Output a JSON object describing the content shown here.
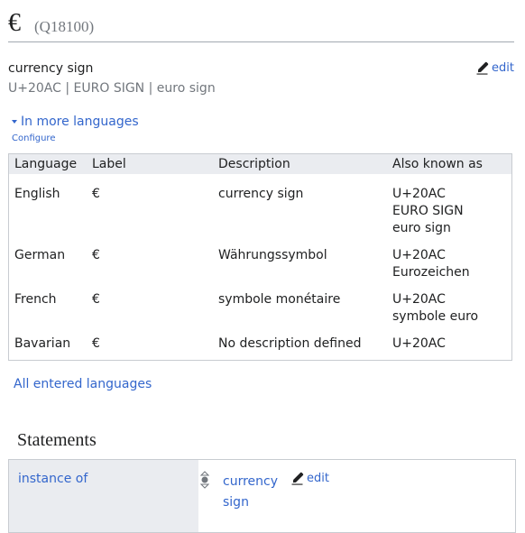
{
  "header": {
    "label": "€",
    "qid": "(Q18100)"
  },
  "description": "currency sign",
  "aliases": [
    "U+20AC",
    "EURO SIGN",
    "euro sign"
  ],
  "alias_separator": " | ",
  "edit_label": "edit",
  "languages_toggle": "In more languages",
  "configure_label": "Configure",
  "table": {
    "headers": [
      "Language",
      "Label",
      "Description",
      "Also known as"
    ],
    "rows": [
      {
        "language": "English",
        "label": "€",
        "description": "currency sign",
        "aliases": [
          "U+20AC",
          "EURO SIGN",
          "euro sign"
        ]
      },
      {
        "language": "German",
        "label": "€",
        "description": "Währungssymbol",
        "aliases": [
          "U+20AC",
          "Eurozeichen"
        ]
      },
      {
        "language": "French",
        "label": "€",
        "description": "symbole monétaire",
        "aliases": [
          "U+20AC",
          "symbole euro"
        ]
      },
      {
        "language": "Bavarian",
        "label": "€",
        "description": "No description defined",
        "aliases": [
          "U+20AC"
        ]
      }
    ]
  },
  "all_languages_link": "All entered languages",
  "statements": {
    "heading": "Statements",
    "items": [
      {
        "property": "instance of",
        "value": "currency sign",
        "edit_label": "edit"
      }
    ]
  },
  "colors": {
    "link": "#3366cc",
    "text": "#202122",
    "muted": "#72777d",
    "header_bg": "#eaecf0",
    "border": "#c8ccd1"
  },
  "icons": {
    "edit": "pencil-icon",
    "toggle": "caret-down-icon",
    "rank": "normal-rank-icon"
  }
}
